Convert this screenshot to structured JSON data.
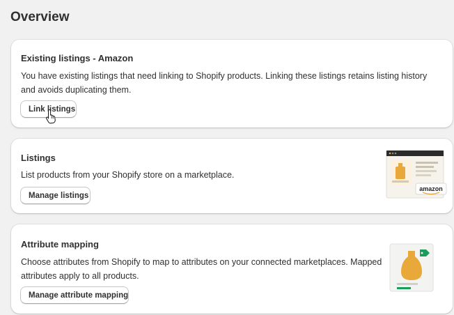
{
  "page": {
    "title": "Overview"
  },
  "cards": {
    "existing_listings": {
      "title": "Existing listings - Amazon",
      "description": "You have existing listings that need linking to Shopify products. Linking these listings retains listing history and avoids duplicating them.",
      "button_label": "Link listings"
    },
    "listings": {
      "title": "Listings",
      "description": "List products from your Shopify store on a marketplace.",
      "button_label": "Manage listings",
      "illustration_label": "amazon"
    },
    "attribute_mapping": {
      "title": "Attribute mapping",
      "description": "Choose attributes from Shopify to map to attributes on your connected marketplaces. Mapped attributes apply to all products.",
      "button_label": "Manage attribute mapping"
    }
  },
  "colors": {
    "background": "#f1f1f1",
    "card": "#ffffff",
    "text": "#303030",
    "accent_green": "#1a9c5b",
    "product_orange": "#e8a93a"
  },
  "icons": {
    "pointer": "hand-pointer-icon"
  }
}
